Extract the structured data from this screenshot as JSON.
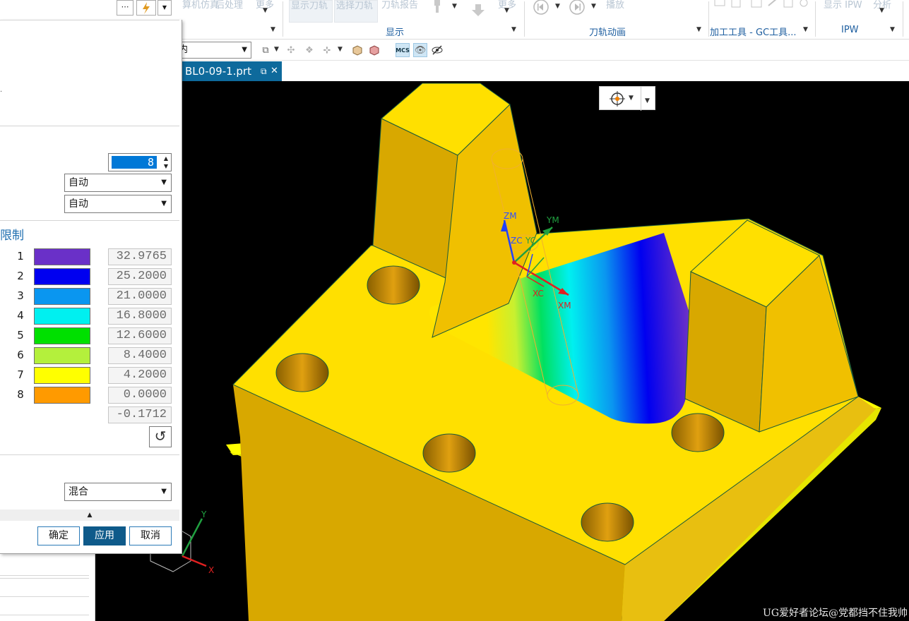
{
  "ribbon": {
    "faded_items": [
      "算机仿真",
      "后处理",
      "更多",
      "显示刀轨",
      "选择刀轨",
      "刀轨报告",
      "更多",
      "播放",
      "显示 IPW",
      "分析"
    ],
    "groups": [
      {
        "label": "显示"
      },
      {
        "label": "刀轨动画"
      },
      {
        "label": "加工工具 - GC工具..."
      },
      {
        "label": "IPW"
      }
    ]
  },
  "toolbar": {
    "filter_value": "内",
    "mcs_label": "MCS"
  },
  "document_tab": {
    "title": "BL0-09-1.prt",
    "close_glyph": "✕"
  },
  "dialog": {
    "levels_value": "8",
    "mode1": "自动",
    "mode2": "自动",
    "section_limits_title": "限制",
    "color_rows": [
      {
        "index": "1",
        "color": "#6a30c8",
        "value": "32.9765"
      },
      {
        "index": "2",
        "color": "#0000f0",
        "value": "25.2000"
      },
      {
        "index": "3",
        "color": "#0a96f0",
        "value": "21.0000"
      },
      {
        "index": "4",
        "color": "#00f0f0",
        "value": "16.8000"
      },
      {
        "index": "5",
        "color": "#00e000",
        "value": "12.6000"
      },
      {
        "index": "6",
        "color": "#b4f03c",
        "value": "8.4000"
      },
      {
        "index": "7",
        "color": "#ffff00",
        "value": "4.2000"
      },
      {
        "index": "8",
        "color": "#ff9a00",
        "value": "0.0000"
      }
    ],
    "min_value": "-0.1712",
    "blend_mode": "混合",
    "buttons": {
      "ok": "确定",
      "apply": "应用",
      "cancel": "取消"
    }
  },
  "viewport": {
    "background": "#000000",
    "axis_labels": {
      "zm": "ZM",
      "ym": "YM",
      "zc": "ZC",
      "yc": "YC",
      "xc": "XC",
      "xm": "XM",
      "y": "Y",
      "x": "X"
    },
    "watermark": "UG爱好者论坛@党都挡不住我帅"
  }
}
